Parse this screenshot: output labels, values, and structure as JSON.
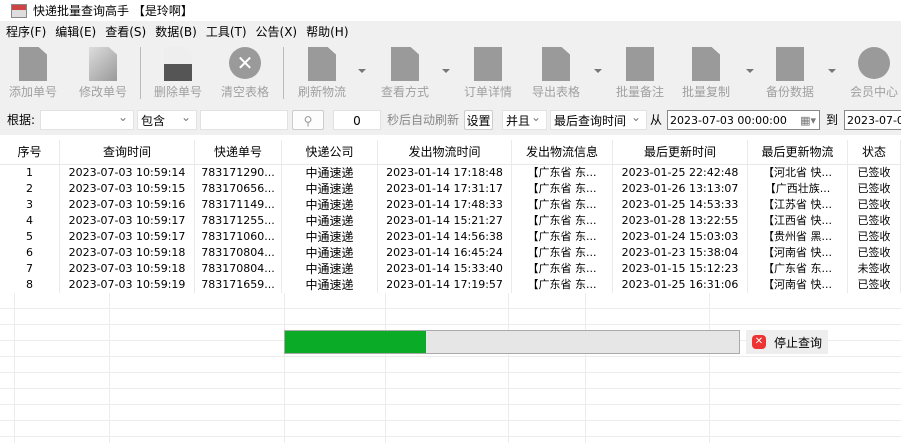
{
  "window": {
    "title": "快递批量查询高手 【是玲啊】"
  },
  "menu": [
    "程序(F)",
    "编辑(E)",
    "查看(S)",
    "数据(B)",
    "工具(T)",
    "公告(X)",
    "帮助(H)"
  ],
  "toolbar": {
    "add": "添加单号",
    "edit": "修改单号",
    "delete": "删除单号",
    "clear": "清空表格",
    "refresh": "刷新物流",
    "view": "查看方式",
    "order": "订单详情",
    "export": "导出表格",
    "note": "批量备注",
    "copy": "批量复制",
    "backup": "备份数据",
    "member": "会员中心"
  },
  "filter": {
    "basis_label": "根据:",
    "basis_value": "",
    "match_value": "包含",
    "keyword": "",
    "refresh_seconds": "0",
    "auto_refresh_label": "秒后自动刷新",
    "settings": "设置",
    "logic": "并且",
    "field": "最后查询时间",
    "from_label": "从",
    "from_value": "2023-07-03 00:00:00",
    "to_label": "到",
    "to_value": "2023-07-0"
  },
  "table": {
    "columns": [
      "序号",
      "查询时间",
      "快递单号",
      "快递公司",
      "发出物流时间",
      "发出物流信息",
      "最后更新时间",
      "最后更新物流",
      "状态"
    ],
    "rows": [
      [
        "1",
        "2023-07-03 10:59:14",
        "783171290...",
        "中通速递",
        "2023-01-14 17:18:48",
        "【广东省 东...",
        "2023-01-25 22:42:48",
        "【河北省 快...",
        "已签收"
      ],
      [
        "2",
        "2023-07-03 10:59:15",
        "783170656...",
        "中通速递",
        "2023-01-14 17:31:17",
        "【广东省 东...",
        "2023-01-26 13:13:07",
        "【广西壮族...",
        "已签收"
      ],
      [
        "3",
        "2023-07-03 10:59:16",
        "783171149...",
        "中通速递",
        "2023-01-14 17:48:33",
        "【广东省 东...",
        "2023-01-25 14:53:33",
        "【江苏省 快...",
        "已签收"
      ],
      [
        "4",
        "2023-07-03 10:59:17",
        "783171255...",
        "中通速递",
        "2023-01-14 15:21:27",
        "【广东省 东...",
        "2023-01-28 13:22:55",
        "【江西省 快...",
        "已签收"
      ],
      [
        "5",
        "2023-07-03 10:59:17",
        "783171060...",
        "中通速递",
        "2023-01-14 14:56:38",
        "【广东省 东...",
        "2023-01-24 15:03:03",
        "【贵州省 黑...",
        "已签收"
      ],
      [
        "6",
        "2023-07-03 10:59:18",
        "783170804...",
        "中通速递",
        "2023-01-14 16:45:24",
        "【广东省 东...",
        "2023-01-23 15:38:04",
        "【河南省 快...",
        "已签收"
      ],
      [
        "7",
        "2023-07-03 10:59:18",
        "783170804...",
        "中通速递",
        "2023-01-14 15:33:40",
        "【广东省 东...",
        "2023-01-15 15:12:23",
        "【广东省 东...",
        "未签收"
      ],
      [
        "8",
        "2023-07-03 10:59:19",
        "783171659...",
        "中通速递",
        "2023-01-14 17:19:57",
        "【广东省 东...",
        "2023-01-25 16:31:06",
        "【河南省 快...",
        "已签收"
      ]
    ]
  },
  "progress": {
    "percent": 31,
    "color": "#0aab27"
  },
  "stop_button": "停止查询"
}
